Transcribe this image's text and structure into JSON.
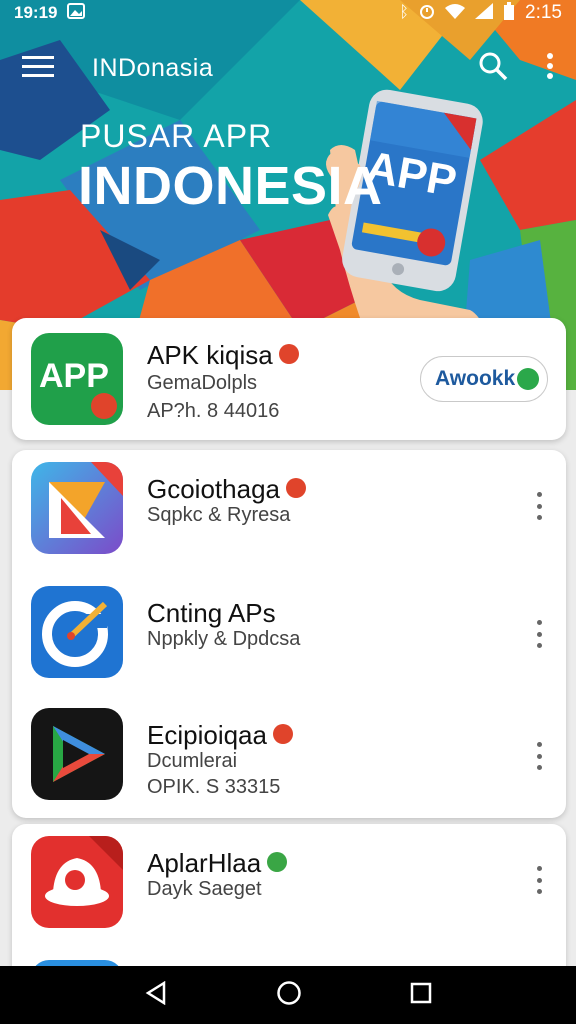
{
  "status_bar": {
    "time": "19:19",
    "battery_time": "2:15"
  },
  "app_bar": {
    "title": "INDonasia"
  },
  "banner": {
    "subtitle": "PUSAR APR",
    "title": "INDONESIA",
    "phone_app_label": "APP"
  },
  "featured": {
    "icon_label": "APP",
    "name": "APK kiqisa",
    "developer": "GemaDolpls",
    "meta": "AP?h. 8 44016",
    "action_label": "Awookk"
  },
  "list": [
    {
      "name": "Gcoiothaga",
      "sub1": "Sqpkc & Ryresa",
      "sub2": ""
    },
    {
      "name": "Cnting APs",
      "sub1": "Nppkly & Dpdcsa",
      "sub2": ""
    },
    {
      "name": "Ecipioiqaa",
      "sub1": "Dcumlerai",
      "sub2": "OPIK. S 33315"
    }
  ],
  "list2": [
    {
      "name": "AplarHlaa",
      "sub1": "Dayk Saeget"
    }
  ],
  "colors": {
    "accent_green": "#1f9a47",
    "badge_red": "#e0442b",
    "link_blue": "#1e5a9e"
  }
}
